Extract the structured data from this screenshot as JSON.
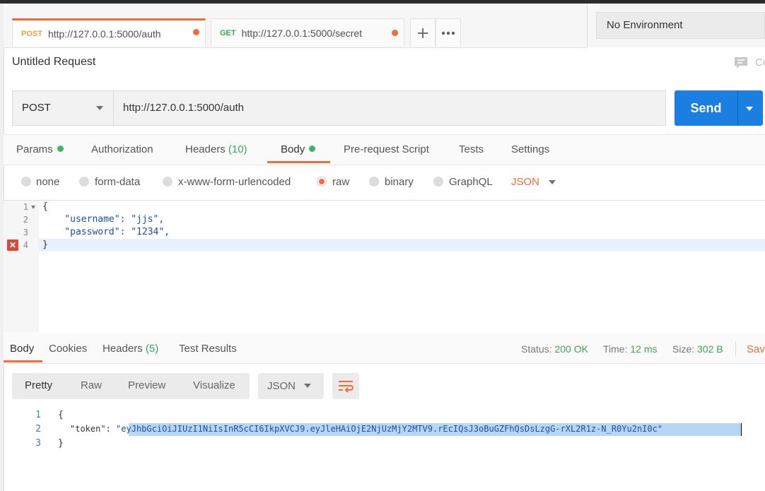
{
  "tabs": [
    {
      "method": "POST",
      "url": "http://127.0.0.1:5000/auth"
    },
    {
      "method": "GET",
      "url": "http://127.0.0.1:5000/secret"
    }
  ],
  "environment": {
    "selected": "No Environment"
  },
  "request": {
    "title": "Untitled Request",
    "comments_label": "Co",
    "method": "POST",
    "url": "http://127.0.0.1:5000/auth",
    "send_label": "Send"
  },
  "request_tabs": {
    "params": "Params",
    "authorization": "Authorization",
    "headers": "Headers",
    "headers_count": "(10)",
    "body": "Body",
    "pre_request": "Pre-request Script",
    "tests": "Tests",
    "settings": "Settings"
  },
  "body_types": {
    "none": "none",
    "form_data": "form-data",
    "urlencoded": "x-www-form-urlencoded",
    "raw": "raw",
    "binary": "binary",
    "graphql": "GraphQL",
    "format": "JSON"
  },
  "editor": {
    "line_numbers": [
      "1",
      "2",
      "3",
      "4"
    ],
    "lines": [
      "{",
      "    \"username\": \"jjs\",",
      "    \"password\": \"1234\",",
      "}"
    ]
  },
  "response": {
    "tabs": {
      "body": "Body",
      "cookies": "Cookies",
      "headers": "Headers",
      "headers_count": "(5)",
      "test_results": "Test Results"
    },
    "status_label": "Status:",
    "status_value": "200 OK",
    "time_label": "Time:",
    "time_value": "12 ms",
    "size_label": "Size:",
    "size_value": "302 B",
    "save_label": "Save",
    "views": {
      "pretty": "Pretty",
      "raw": "Raw",
      "preview": "Preview",
      "visualize": "Visualize"
    },
    "format": "JSON",
    "line_numbers": [
      "1",
      "2",
      "3"
    ],
    "open_brace": "{",
    "token_key": "\"token\"",
    "colon": ": ",
    "token_value": "eyJhbGciOiJIUzI1NiIsInR5cCI6IkpXVCJ9.eyJleHAiOjE2NjUzMjY2MTV9.rEcIQsJ3oBuGZFhQsDsLzgG-rXL2R1z-N_R0Yu2nI0c",
    "close_brace": "}"
  },
  "colors": {
    "accent": "#f26b3a",
    "send": "#1a7fe0",
    "status_ok": "#3fa35b"
  }
}
